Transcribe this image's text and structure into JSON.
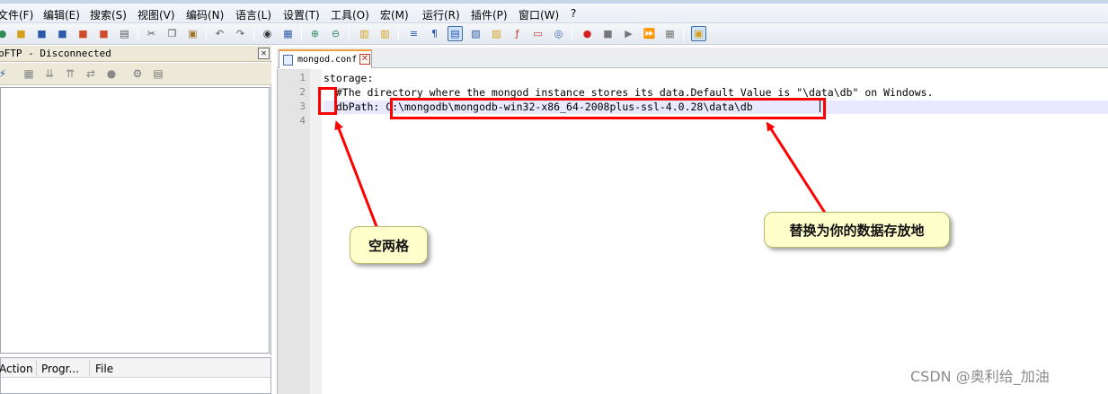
{
  "menu": [
    "文件(F)",
    "编辑(E)",
    "搜索(S)",
    "视图(V)",
    "编码(N)",
    "语言(L)",
    "设置(T)",
    "工具(O)",
    "宏(M)",
    "运行(R)",
    "插件(P)",
    "窗口(W)",
    "?"
  ],
  "ftp_panel": {
    "title": "pFTP - Disconnected",
    "close_glyph": "✕",
    "queue_columns": [
      "Action",
      "Progr...",
      "File"
    ]
  },
  "editor": {
    "tab_name": "mongod.conf",
    "tab_close_glyph": "✕",
    "line_numbers": [
      "1",
      "2",
      "3",
      "4"
    ],
    "lines": [
      "storage:",
      "  #The directory where the mongod instance stores its data.Default Value is \"\\data\\db\" on Windows.",
      "  dbPath: C:\\mongodb\\mongodb-win32-x86_64-2008plus-ssl-4.0.28\\data\\db",
      ""
    ]
  },
  "annotations": {
    "indent_label": "空两格",
    "path_label": "替换为你的数据存放地",
    "box_color": "#ff0000",
    "callout_color": "#ffffcc"
  },
  "watermark": "CSDN @奥利给_加油"
}
